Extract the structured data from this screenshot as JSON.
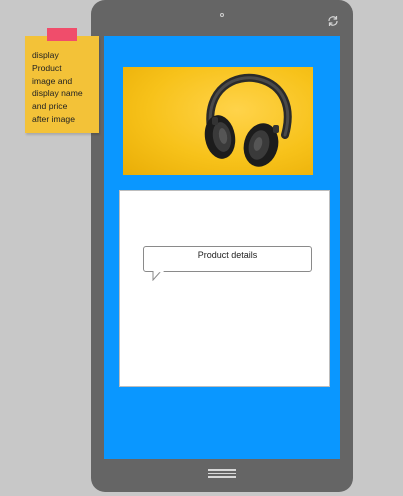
{
  "sticky_note": {
    "text": "display\nProduct\nimage and\ndisplay name\nand price\nafter image"
  },
  "device": {
    "camera_icon": "camera-dot",
    "rotate_icon": "rotate-icon",
    "home_icon": "home-menu-icon"
  },
  "screen": {
    "background_color": "#0a97ff",
    "product_image": "headphones-on-yellow",
    "details_callout": "Product details"
  },
  "colors": {
    "sticky": "#f3c238",
    "sticky_tab": "#f04d6b",
    "device_frame": "#656565",
    "page_background": "#c8c8c8"
  }
}
